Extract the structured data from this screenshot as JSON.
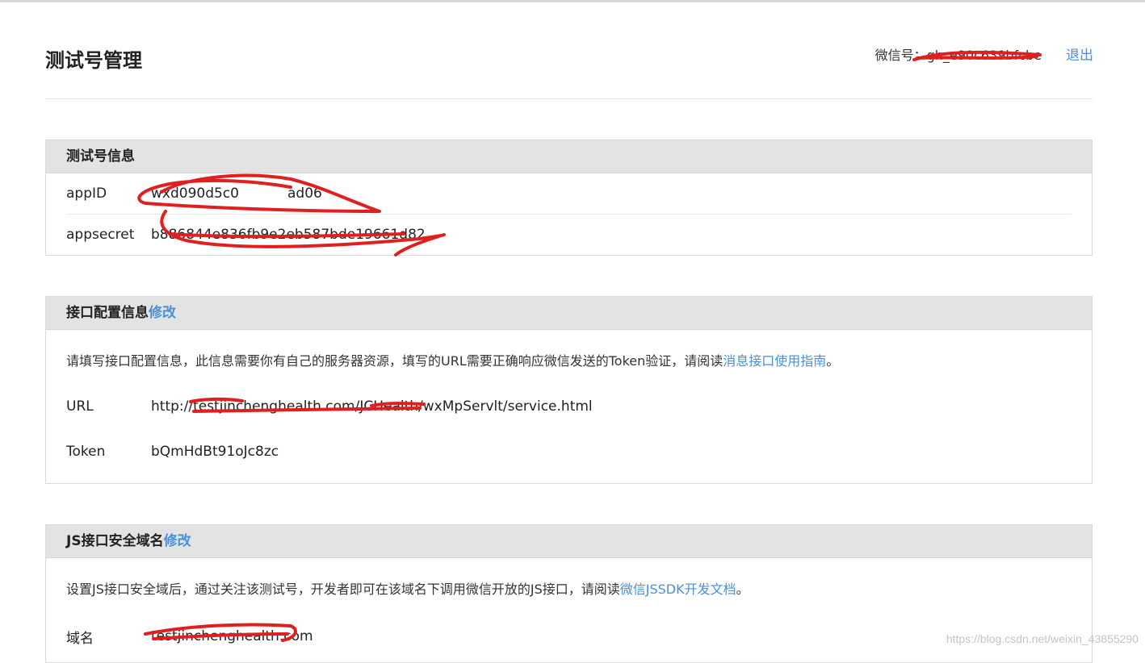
{
  "page": {
    "title": "测试号管理",
    "account_label": "微信号：",
    "account_id": "gh_e90c639bfcbe",
    "logout_label": "退出"
  },
  "test_info": {
    "title": "测试号信息",
    "appid_label": "appID",
    "appid_value": "wxd090d5c0",
    "appid_tail": "ad06",
    "appsecret_label": "appsecret",
    "appsecret_value": "b886844e836fb9e2eb587bde19661d82"
  },
  "interface_config": {
    "title": "接口配置信息",
    "edit_label": "修改",
    "description": "请填写接口配置信息，此信息需要你有自己的服务器资源，填写的URL需要正确响应微信发送的Token验证，请阅读",
    "guide_link": "消息接口使用指南",
    "period": "。",
    "url_label": "URL",
    "url_value": "http://testjinchenghealth.com/JCHealth/wxMpServlt/service.html",
    "token_label": "Token",
    "token_value": "bQmHdBt91oJc8zc"
  },
  "js_domain": {
    "title": "JS接口安全域名",
    "edit_label": "修改",
    "description": "设置JS接口安全域后，通过关注该测试号，开发者即可在该域名下调用微信开放的JS接口，请阅读",
    "doc_link": "微信JSSDK开发文档",
    "period": "。",
    "domain_label": "域名",
    "domain_value": "testjinchenghealth.com"
  },
  "watermark": "https://blog.csdn.net/weixin_43855290",
  "colors": {
    "link": "#4a90d9",
    "panel_header": "#e3e3e3",
    "redaction": "#e02020"
  }
}
